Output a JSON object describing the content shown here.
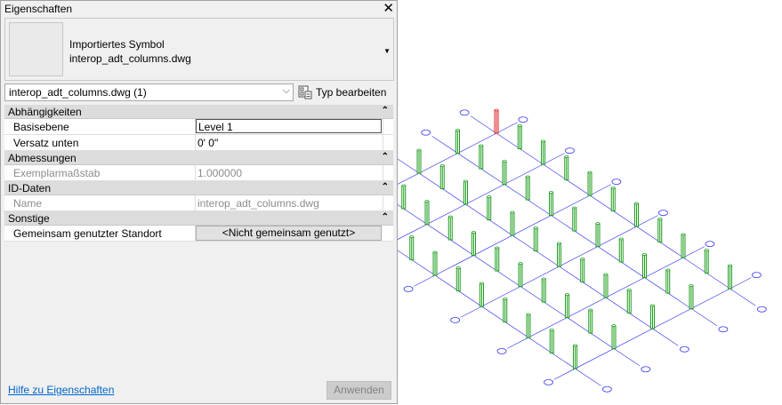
{
  "panel": {
    "title": "Eigenschaften",
    "close_glyph": "✕"
  },
  "type_box": {
    "line1": "Importiertes Symbol",
    "line2": "interop_adt_columns.dwg",
    "dropdown_glyph": "▼"
  },
  "selector": {
    "value": "interop_adt_columns.dwg (1)",
    "arrow": "⌵",
    "edit_type_label": "Typ bearbeiten",
    "edit_type_icon": "edit-type-icon"
  },
  "groups": {
    "constraints": {
      "label": "Abhängigkeiten",
      "toggle": "⌃",
      "base_level_name": "Basisebene",
      "base_level_value": "Level 1",
      "base_offset_name": "Versatz unten",
      "base_offset_value": "0'  0\""
    },
    "dimensions": {
      "label": "Abmessungen",
      "toggle": "⌃",
      "scale_name": "Exemplarmaßstab",
      "scale_value": "1.000000"
    },
    "identity": {
      "label": "ID-Daten",
      "toggle": "⌃",
      "name_name": "Name",
      "name_value": "interop_adt_columns.dwg"
    },
    "other": {
      "label": "Sonstige",
      "toggle": "⌃",
      "shared_name": "Gemeinsam genutzter Standort",
      "shared_value": "<Nicht gemeinsam genutzt>"
    }
  },
  "footer": {
    "help_link": "Hilfe zu Eigenschaften",
    "apply_label": "Anwenden"
  },
  "colors": {
    "grid_line": "#3c3cf0",
    "column_green": "#1e9e1e",
    "column_selected": "#e01e1e"
  }
}
